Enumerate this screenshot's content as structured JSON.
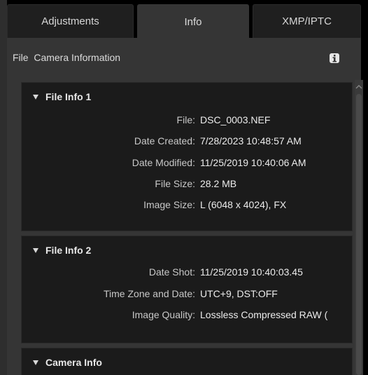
{
  "tabs": [
    {
      "label": "Adjustments",
      "active": false
    },
    {
      "label": "Info",
      "active": true
    },
    {
      "label": "XMP/IPTC",
      "active": false
    }
  ],
  "header": {
    "title": "File  Camera Information",
    "icon": "info-icon"
  },
  "sections": [
    {
      "title": "File Info 1",
      "rows": [
        {
          "label": "File:",
          "value": "DSC_0003.NEF"
        },
        {
          "label": "Date Created:",
          "value": "7/28/2023 10:48:57 AM"
        },
        {
          "label": "Date Modified:",
          "value": "11/25/2019 10:40:06 AM"
        },
        {
          "label": "File Size:",
          "value": "28.2 MB"
        },
        {
          "label": "Image Size:",
          "value": "L (6048 x 4024), FX"
        }
      ]
    },
    {
      "title": "File Info 2",
      "rows": [
        {
          "label": "Date Shot:",
          "value": "11/25/2019 10:40:03.45"
        },
        {
          "label": "Time Zone and Date:",
          "value": "UTC+9, DST:OFF"
        },
        {
          "label": "Image Quality:",
          "value": "Lossless Compressed RAW ("
        }
      ]
    },
    {
      "title": "Camera Info",
      "rows": []
    }
  ],
  "colors": {
    "background": "#000000",
    "panel": "#353535",
    "section": "#1b1b1b",
    "text": "#e6e6e6"
  }
}
